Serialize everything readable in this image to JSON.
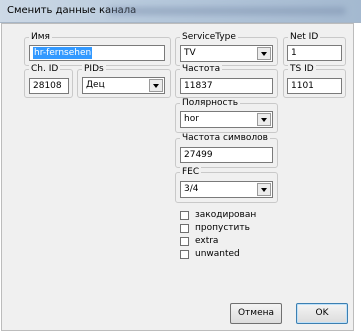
{
  "window": {
    "title": "Сменить данные канала"
  },
  "fields": {
    "name": {
      "label": "Имя",
      "value": "hr-fernsehen"
    },
    "service_type": {
      "label": "ServiceType",
      "value": "TV"
    },
    "net_id": {
      "label": "Net ID",
      "value": "1"
    },
    "ch_id": {
      "label": "Ch. ID",
      "value": "28108"
    },
    "pids": {
      "label": "PIDs",
      "value": "Дец"
    },
    "frequency": {
      "label": "Частота",
      "value": "11837"
    },
    "ts_id": {
      "label": "TS ID",
      "value": "1101"
    },
    "polarity": {
      "label": "Полярность",
      "value": "hor"
    },
    "symbol_rate": {
      "label": "Частота символов",
      "value": "27499"
    },
    "fec": {
      "label": "FEC",
      "value": "3/4"
    }
  },
  "checkboxes": [
    {
      "label": "закодирован",
      "checked": false
    },
    {
      "label": "пропустить",
      "checked": false
    },
    {
      "label": "extra",
      "checked": false
    },
    {
      "label": "unwanted",
      "checked": false
    }
  ],
  "buttons": {
    "cancel": "Отмена",
    "ok": "OK"
  }
}
